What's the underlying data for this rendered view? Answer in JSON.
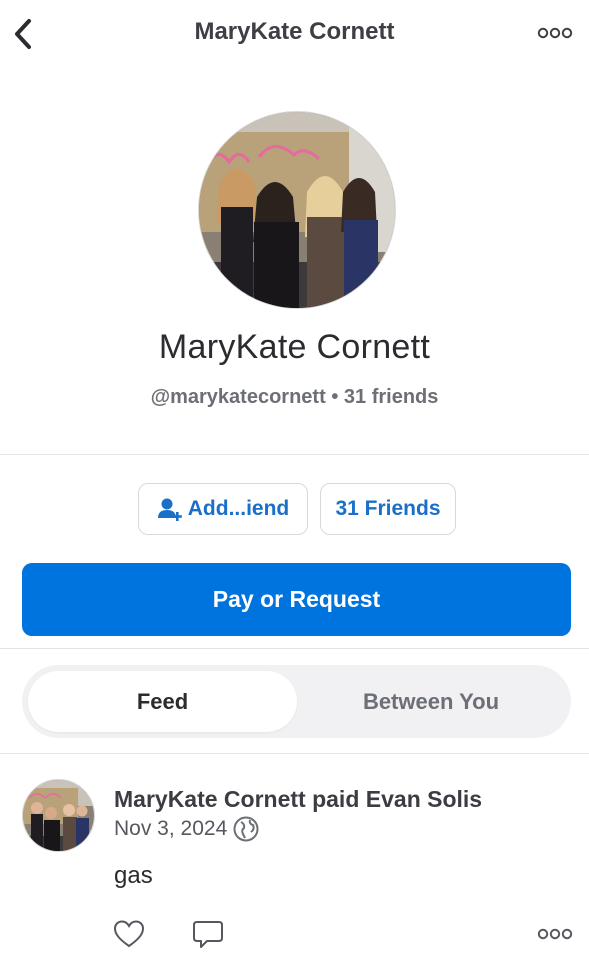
{
  "header": {
    "title": "MaryKate Cornett",
    "back_icon": "chevron-left-icon",
    "more_icon": "more-dots-icon"
  },
  "profile": {
    "avatar_description_icon": "profile-photo",
    "name": "MaryKate Cornett",
    "handle": "@marykatecornett",
    "separator": "•",
    "friends_count_text": "31 friends"
  },
  "actions": {
    "add_friend_label": "Add...iend",
    "add_friend_icon": "add-person-icon",
    "friends_label": "31 Friends",
    "pay_label": "Pay or Request"
  },
  "tabs": [
    {
      "label": "Feed",
      "active": true
    },
    {
      "label": "Between You",
      "active": false
    }
  ],
  "feed": {
    "items": [
      {
        "headline": "MaryKate Cornett paid Evan Solis",
        "date": "Nov 3, 2024",
        "visibility_icon": "globe-icon",
        "note": "gas",
        "like_icon": "heart-icon",
        "comment_icon": "comment-icon",
        "more_icon": "more-dots-icon"
      }
    ]
  },
  "colors": {
    "brand_blue": "#0074de",
    "link_blue": "#1a6fc9",
    "text_dark": "#2b2c30",
    "text_muted": "#6c6f76",
    "divider": "#e3e3e6",
    "tab_bg": "#f1f1f3"
  }
}
